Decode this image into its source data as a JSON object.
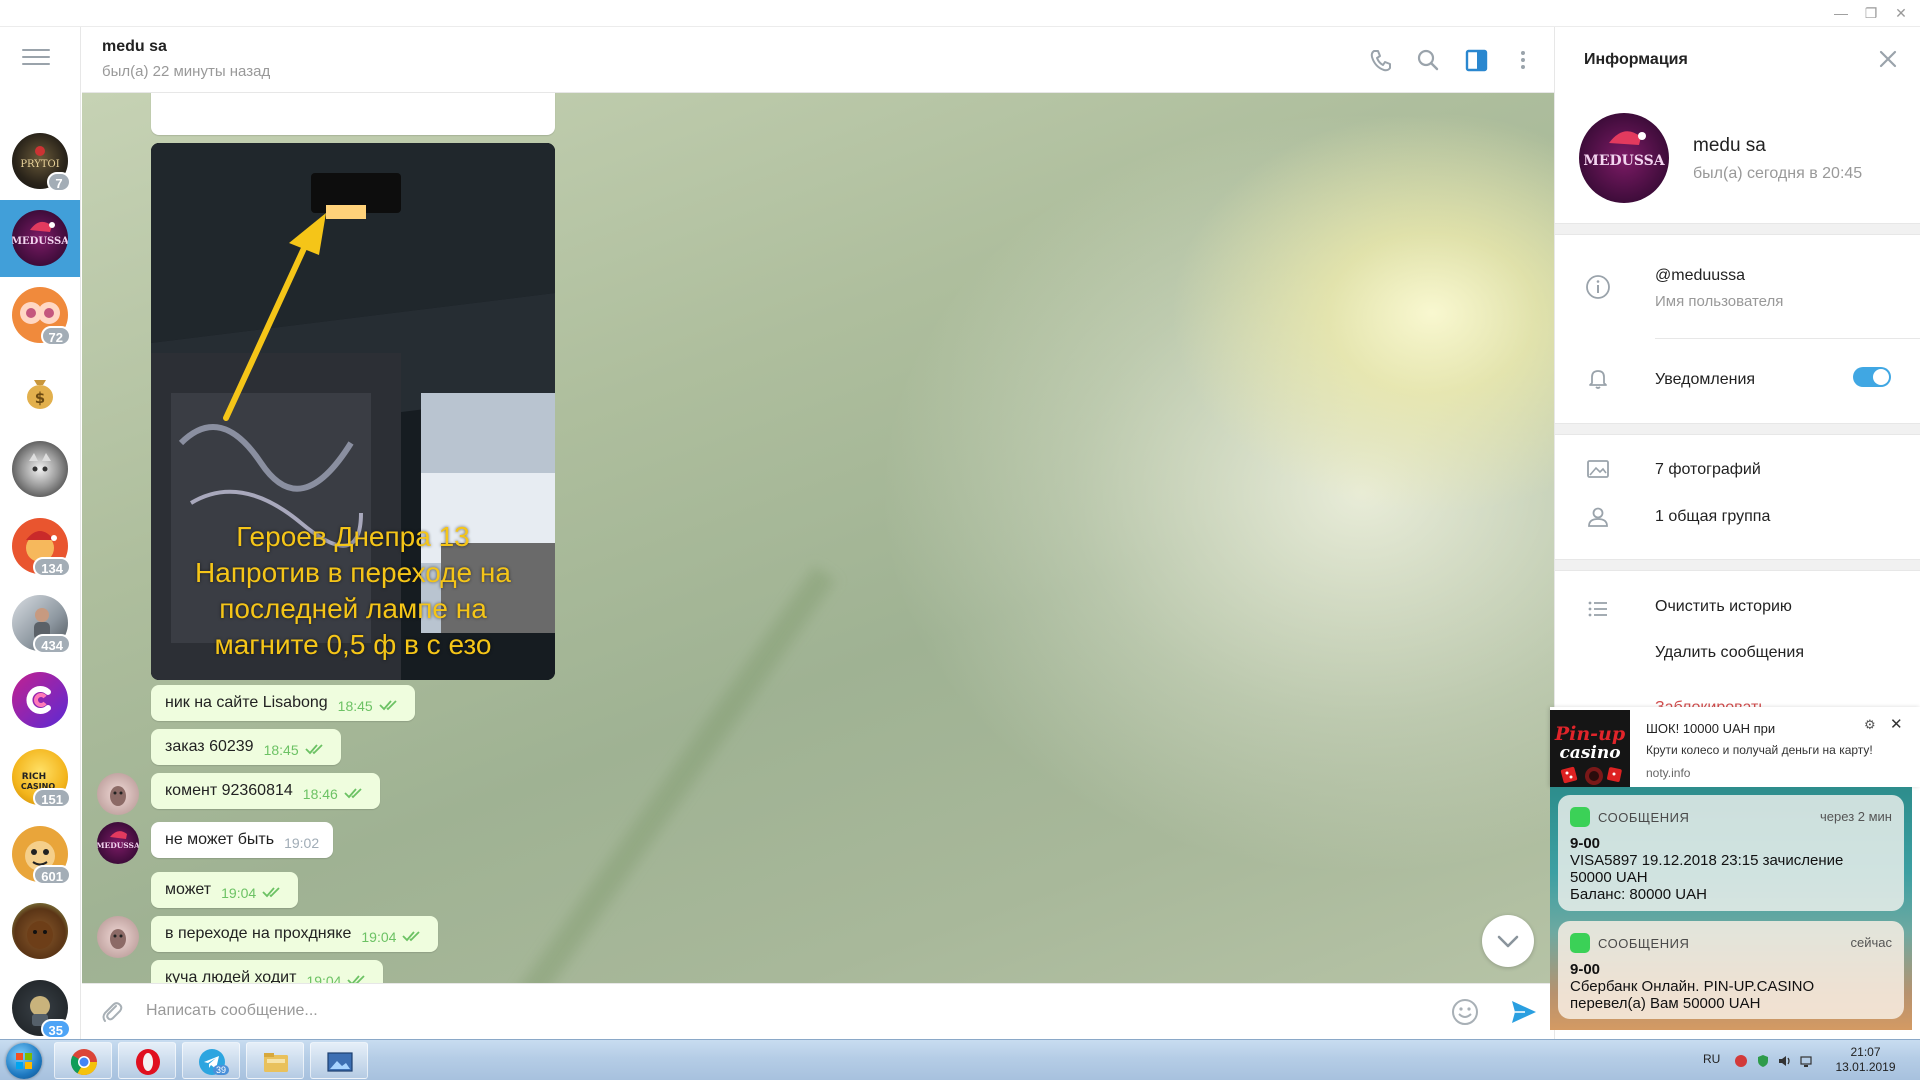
{
  "chat": {
    "peer_name": "medu sa",
    "peer_status": "был(а) 22 минуты назад",
    "photo_caption": [
      "Героев Днепра 13",
      "Напротив в переходе на",
      "последней лампе на",
      "магните 0,5 ф в с езо"
    ],
    "messages": [
      {
        "text": "ник на сайте Lisabong",
        "time": "18:45"
      },
      {
        "text": "заказ 60239",
        "time": "18:45"
      },
      {
        "text": "комент 92360814",
        "time": "18:46"
      },
      {
        "text": "не может быть",
        "time": "19:02"
      },
      {
        "text": "может",
        "time": "19:04"
      },
      {
        "text": "в переходе на прохдняке",
        "time": "19:04"
      },
      {
        "text": "куча людей ходит",
        "time": "19:04"
      }
    ],
    "composer_placeholder": "Написать сообщение..."
  },
  "sidebar": {
    "badges": [
      "7",
      "72",
      "134",
      "434",
      "151",
      "601",
      "35"
    ]
  },
  "info": {
    "title": "Информация",
    "name": "medu sa",
    "status": "был(а) сегодня в 20:45",
    "avatar_text": "MEDUSSA",
    "username": "@meduussa",
    "username_label": "Имя пользователя",
    "notifications_label": "Уведомления",
    "notifications_on": true,
    "photos": "7 фотографий",
    "groups": "1 общая группа",
    "clear_history": "Очистить историю",
    "delete_messages": "Удалить сообщения",
    "block": "Заблокировать"
  },
  "popup": {
    "logo_line1": "Pin-up",
    "logo_line2": "casino",
    "title": "ШОК! 10000 UAH при",
    "text": "Крути колесо и получай деньги на карту!",
    "source": "noty.info"
  },
  "ios": {
    "cards": [
      {
        "app": "СООБЩЕНИЯ",
        "when": "через 2 мин",
        "sender": "9-00",
        "lines": [
          "VISA5897 19.12.2018 23:15 зачисление",
          "50000 UAH",
          "Баланс: 80000 UAH"
        ]
      },
      {
        "app": "СООБЩЕНИЯ",
        "when": "сейчас",
        "sender": "9-00",
        "lines": [
          "Сбербанк Онлайн. PIN-UP.CASINO",
          "перевел(а) Вам 50000 UAH"
        ]
      }
    ]
  },
  "taskbar": {
    "lang": "RU",
    "time": "21:07",
    "date": "13.01.2019",
    "telegram_badge": "39"
  },
  "colors": {
    "accent": "#419fd9",
    "bubble_out": "#effdde",
    "check": "#6cc264"
  }
}
